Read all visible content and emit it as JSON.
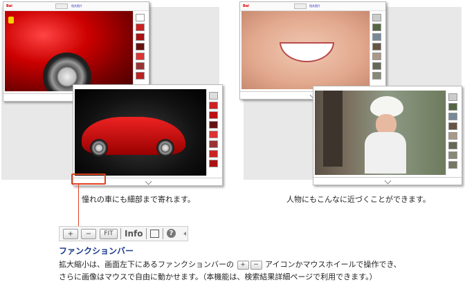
{
  "windows": {
    "logo": "Bai",
    "toplink": "相关图片"
  },
  "captions": {
    "car": "憧れの車にも細部まで寄れます。",
    "person": "人物にもこんなに近づくことができます。"
  },
  "function_bar": {
    "plus_label": "+",
    "minus_label": "−",
    "fit_label": "FIT",
    "info_label": "Info",
    "help_label": "?",
    "title": "ファンクションバー",
    "desc_line1_a": "拡大縮小は、画面左下にあるファンクションバーの",
    "desc_line1_b": "アイコンかマウスホイールで操作でき、",
    "desc_line2": "さらに画像はマウスで自由に動かせます。（本機能は、検索結果詳細ページで利用できます。）"
  },
  "colors": {
    "highlight": "#e04020",
    "title": "#1a3a8a"
  }
}
